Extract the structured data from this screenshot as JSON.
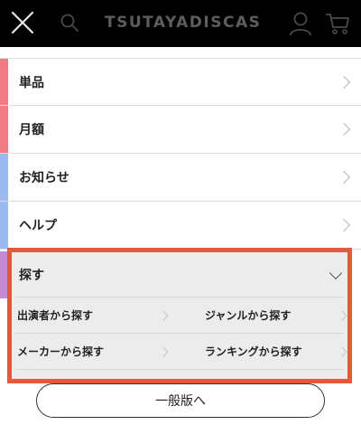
{
  "header": {
    "logo_text": "TSUTAYADISCAS",
    "close_icon": "close-icon",
    "search_icon": "search-icon",
    "user_icon": "user-icon",
    "cart_icon": "cart-icon"
  },
  "menu": {
    "items": [
      {
        "label": "単品",
        "stripe_color": "#f07b85"
      },
      {
        "label": "月額",
        "stripe_color": "#f07b85"
      },
      {
        "label": "お知らせ",
        "stripe_color": "#9dbaf0"
      },
      {
        "label": "ヘルプ",
        "stripe_color": "#9dbaf0"
      }
    ]
  },
  "search_section": {
    "title": "探す",
    "accent_color": "#e05a3e",
    "links": [
      {
        "label": "出演者から探す"
      },
      {
        "label": "ジャンルから探す"
      },
      {
        "label": "メーカーから探す"
      },
      {
        "label": "ランキングから探す"
      }
    ]
  },
  "footer": {
    "pc_version_label": "一般版へ"
  }
}
